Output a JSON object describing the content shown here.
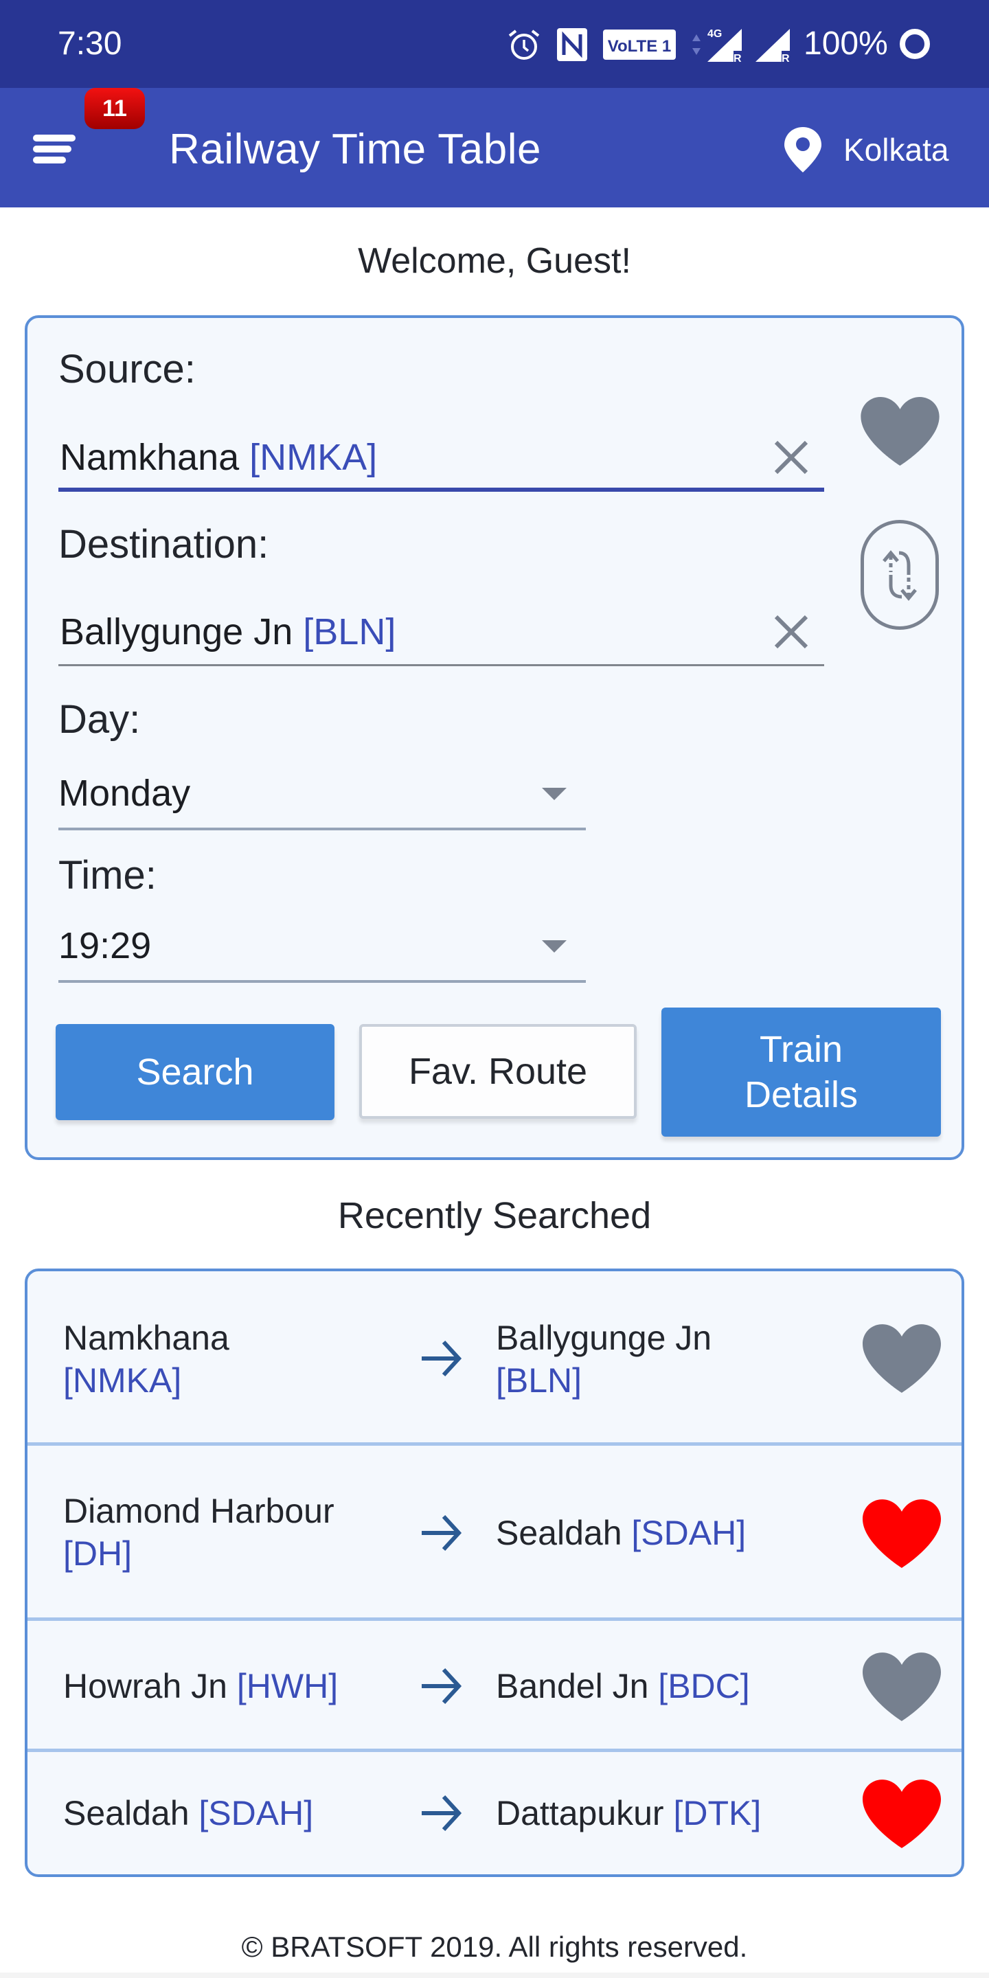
{
  "status_bar": {
    "time": "7:30",
    "icons": [
      "alarm-icon",
      "nfc-icon",
      "volte-icon",
      "data-arrows-icon",
      "signal-4g-icon",
      "signal-icon"
    ],
    "volte_label": "VoLTE 1",
    "network_label": "4G",
    "roaming_label": "R",
    "battery": "100%"
  },
  "app_bar": {
    "title": "Railway Time Table",
    "notification_count": "11",
    "location": "Kolkata",
    "menu_icon": "hamburger-menu-icon",
    "location_icon": "map-pin-icon"
  },
  "welcome": "Welcome, Guest!",
  "form": {
    "source_label": "Source:",
    "source_name": "Namkhana",
    "source_code": "[NMKA]",
    "destination_label": "Destination:",
    "destination_name": "Ballygunge Jn",
    "destination_code": "[BLN]",
    "day_label": "Day:",
    "day_value": "Monday",
    "time_label": "Time:",
    "time_value": "19:29",
    "favorite": false,
    "buttons": {
      "search": "Search",
      "fav_route": "Fav. Route",
      "train_details": "Train Details"
    }
  },
  "recent": {
    "title": "Recently Searched",
    "items": [
      {
        "from_name": "Namkhana",
        "from_code": "[NMKA]",
        "to_name": "Ballygunge Jn",
        "to_code": "[BLN]",
        "favorite": false
      },
      {
        "from_name": "Diamond Harbour",
        "from_code": "[DH]",
        "to_name": "Sealdah",
        "to_code": "[SDAH]",
        "favorite": true
      },
      {
        "from_name": "Howrah Jn",
        "from_code": "[HWH]",
        "to_name": "Bandel Jn",
        "to_code": "[BDC]",
        "favorite": false
      },
      {
        "from_name": "Sealdah",
        "from_code": "[SDAH]",
        "to_name": "Dattapukur",
        "to_code": "[DTK]",
        "favorite": true
      }
    ]
  },
  "colors": {
    "status_bar": "#283593",
    "app_bar": "#3A4DB5",
    "accent": "#3F86D8",
    "station_code": "#3A4DB8",
    "favorite_on": "#FF0000",
    "favorite_off": "#76808F"
  },
  "footer": "© BRATSOFT 2019. All rights reserved."
}
